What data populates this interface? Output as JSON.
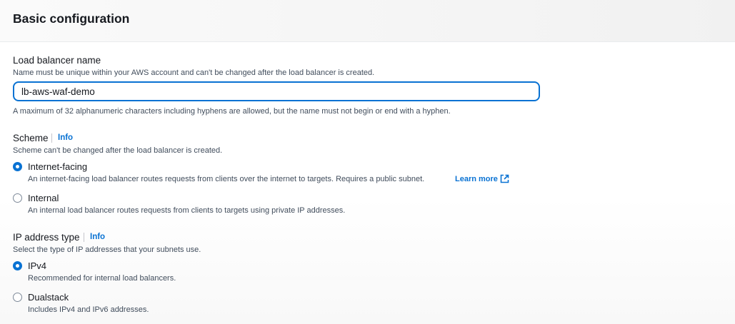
{
  "section": {
    "title": "Basic configuration"
  },
  "lb_name": {
    "label": "Load balancer name",
    "description": "Name must be unique within your AWS account and can't be changed after the load balancer is created.",
    "value": "lb-aws-waf-demo",
    "constraint": "A maximum of 32 alphanumeric characters including hyphens are allowed, but the name must not begin or end with a hyphen."
  },
  "scheme": {
    "label": "Scheme",
    "info": "Info",
    "description": "Scheme can't be changed after the load balancer is created.",
    "options": [
      {
        "label": "Internet-facing",
        "description": "An internet-facing load balancer routes requests from clients over the internet to targets. Requires a public subnet.",
        "link": "Learn more",
        "selected": true
      },
      {
        "label": "Internal",
        "description": "An internal load balancer routes requests from clients to targets using private IP addresses.",
        "selected": false
      }
    ]
  },
  "ip_type": {
    "label": "IP address type",
    "info": "Info",
    "description": "Select the type of IP addresses that your subnets use.",
    "options": [
      {
        "label": "IPv4",
        "description": "Recommended for internal load balancers.",
        "selected": true
      },
      {
        "label": "Dualstack",
        "description": "Includes IPv4 and IPv6 addresses.",
        "selected": false
      }
    ]
  },
  "colors": {
    "accent": "#0972d3",
    "text": "#16191f",
    "muted": "#414d5c"
  },
  "icons": {
    "external_link": "external-link-icon"
  }
}
